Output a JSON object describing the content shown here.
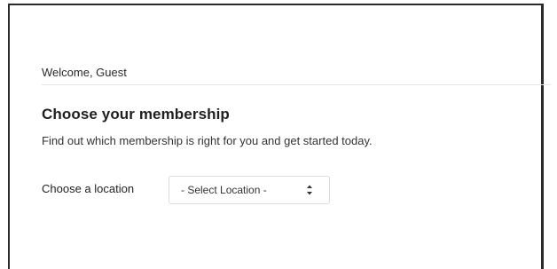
{
  "greeting": "Welcome, Guest",
  "membership": {
    "heading": "Choose your membership",
    "description": "Find out which membership is right for you and get started today."
  },
  "location": {
    "label": "Choose a location",
    "select": {
      "selected_value": "- Select Location -",
      "icon": "up-down-chevron-icon"
    }
  },
  "colors": {
    "frame_border": "#2b2b2b",
    "divider": "#e6e6e6",
    "select_border": "#dcdcdc",
    "text": "#222222"
  }
}
